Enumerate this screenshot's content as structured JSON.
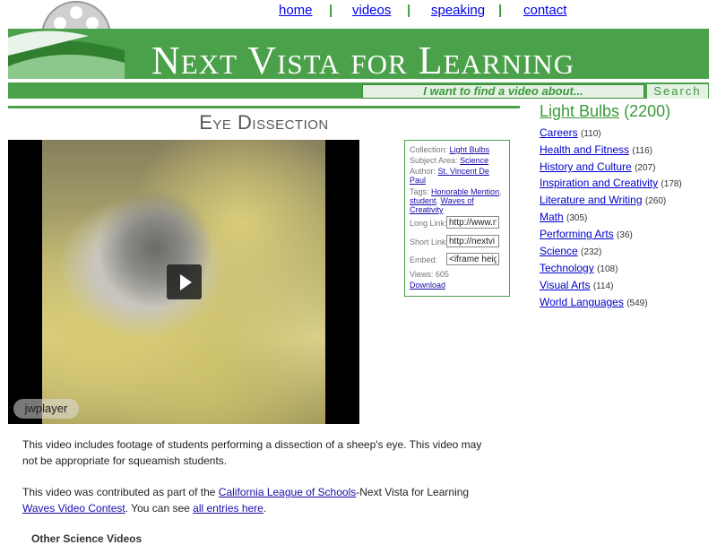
{
  "nav": {
    "home": "home",
    "videos": "videos",
    "speaking": "speaking",
    "contact": "contact",
    "separator": "|"
  },
  "site": {
    "title": "Next Vista for Learning"
  },
  "search": {
    "placeholder": "I want to find a video about...",
    "button": "Search"
  },
  "video": {
    "title": "Eye Dissection",
    "player_badge": "jwplayer"
  },
  "info": {
    "collection_label": "Collection:",
    "collection": "Light Bulbs",
    "subject_label": "Subject Area:",
    "subject": "Science",
    "author_label": "Author:",
    "author": "St. Vincent De Paul",
    "tags_label": "Tags:",
    "tag1": "Honorable Mention",
    "tag2": "student",
    "tag3": "Waves of Creativity",
    "long_link_label": "Long Link:",
    "long_link_value": "http://www.n",
    "short_link_label": "Short Link:",
    "short_link_value": "http://nextvi",
    "embed_label": "Embed:",
    "embed_value": "<iframe heig",
    "views_label": "Views:",
    "views": "605",
    "download": "Download"
  },
  "sidebar": {
    "heading": "Light Bulbs",
    "heading_count": "(2200)",
    "categories": [
      {
        "label": "Careers",
        "count": "(110)"
      },
      {
        "label": "Health and Fitness",
        "count": "(116)"
      },
      {
        "label": "History and Culture",
        "count": "(207)"
      },
      {
        "label": "Inspiration and Creativity",
        "count": "(178)"
      },
      {
        "label": "Literature and Writing",
        "count": "(260)"
      },
      {
        "label": "Math",
        "count": "(305)"
      },
      {
        "label": "Performing Arts",
        "count": "(36)"
      },
      {
        "label": "Science",
        "count": "(232)"
      },
      {
        "label": "Technology",
        "count": "(108)"
      },
      {
        "label": "Visual Arts",
        "count": "(114)"
      },
      {
        "label": "World Languages",
        "count": "(549)"
      }
    ]
  },
  "description": {
    "p1": "This video includes footage of students performing a dissection of a sheep's eye. This video may not be appropriate for squeamish students.",
    "p2_a": "This video was contributed as part of the ",
    "p2_link1": "California League of Schools",
    "p2_b": "-Next Vista for Learning ",
    "p2_link2": "Waves Video Contest",
    "p2_c": ". You can see ",
    "p2_link3": "all entries here",
    "p2_d": ".",
    "next_heading": "Other Science Videos"
  },
  "colors": {
    "brand_green": "#4aa14a",
    "light_green": "#e6f1e6",
    "link": "#0000cc"
  }
}
